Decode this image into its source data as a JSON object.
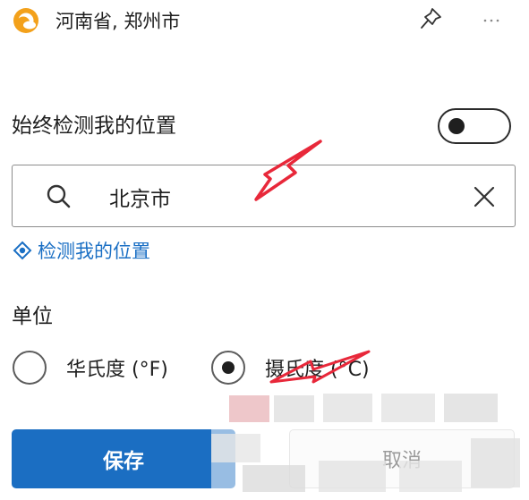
{
  "header": {
    "location_title": "河南省, 郑州市",
    "icons": {
      "app": "weather-app-icon",
      "pin": "pin-icon",
      "more": "more-horizontal-icon"
    }
  },
  "location_detection": {
    "label": "始终检测我的位置",
    "toggle_on": false
  },
  "search": {
    "value": "北京市",
    "icons": {
      "search": "search-icon",
      "clear": "close-icon"
    }
  },
  "detect_link": {
    "label": "检测我的位置",
    "icon": "location-icon"
  },
  "units": {
    "heading": "单位",
    "options": [
      {
        "label": "华氏度 (°F)",
        "selected": false
      },
      {
        "label": "摄氏度 (°C)",
        "selected": true
      }
    ]
  },
  "buttons": {
    "save_label": "保存",
    "cancel_label": "取消"
  },
  "colors": {
    "accent": "#1b6ec2",
    "link": "#1a6fc4",
    "annotation_arrow": "#e8283a",
    "app_icon_orange": "#f3a11b"
  }
}
